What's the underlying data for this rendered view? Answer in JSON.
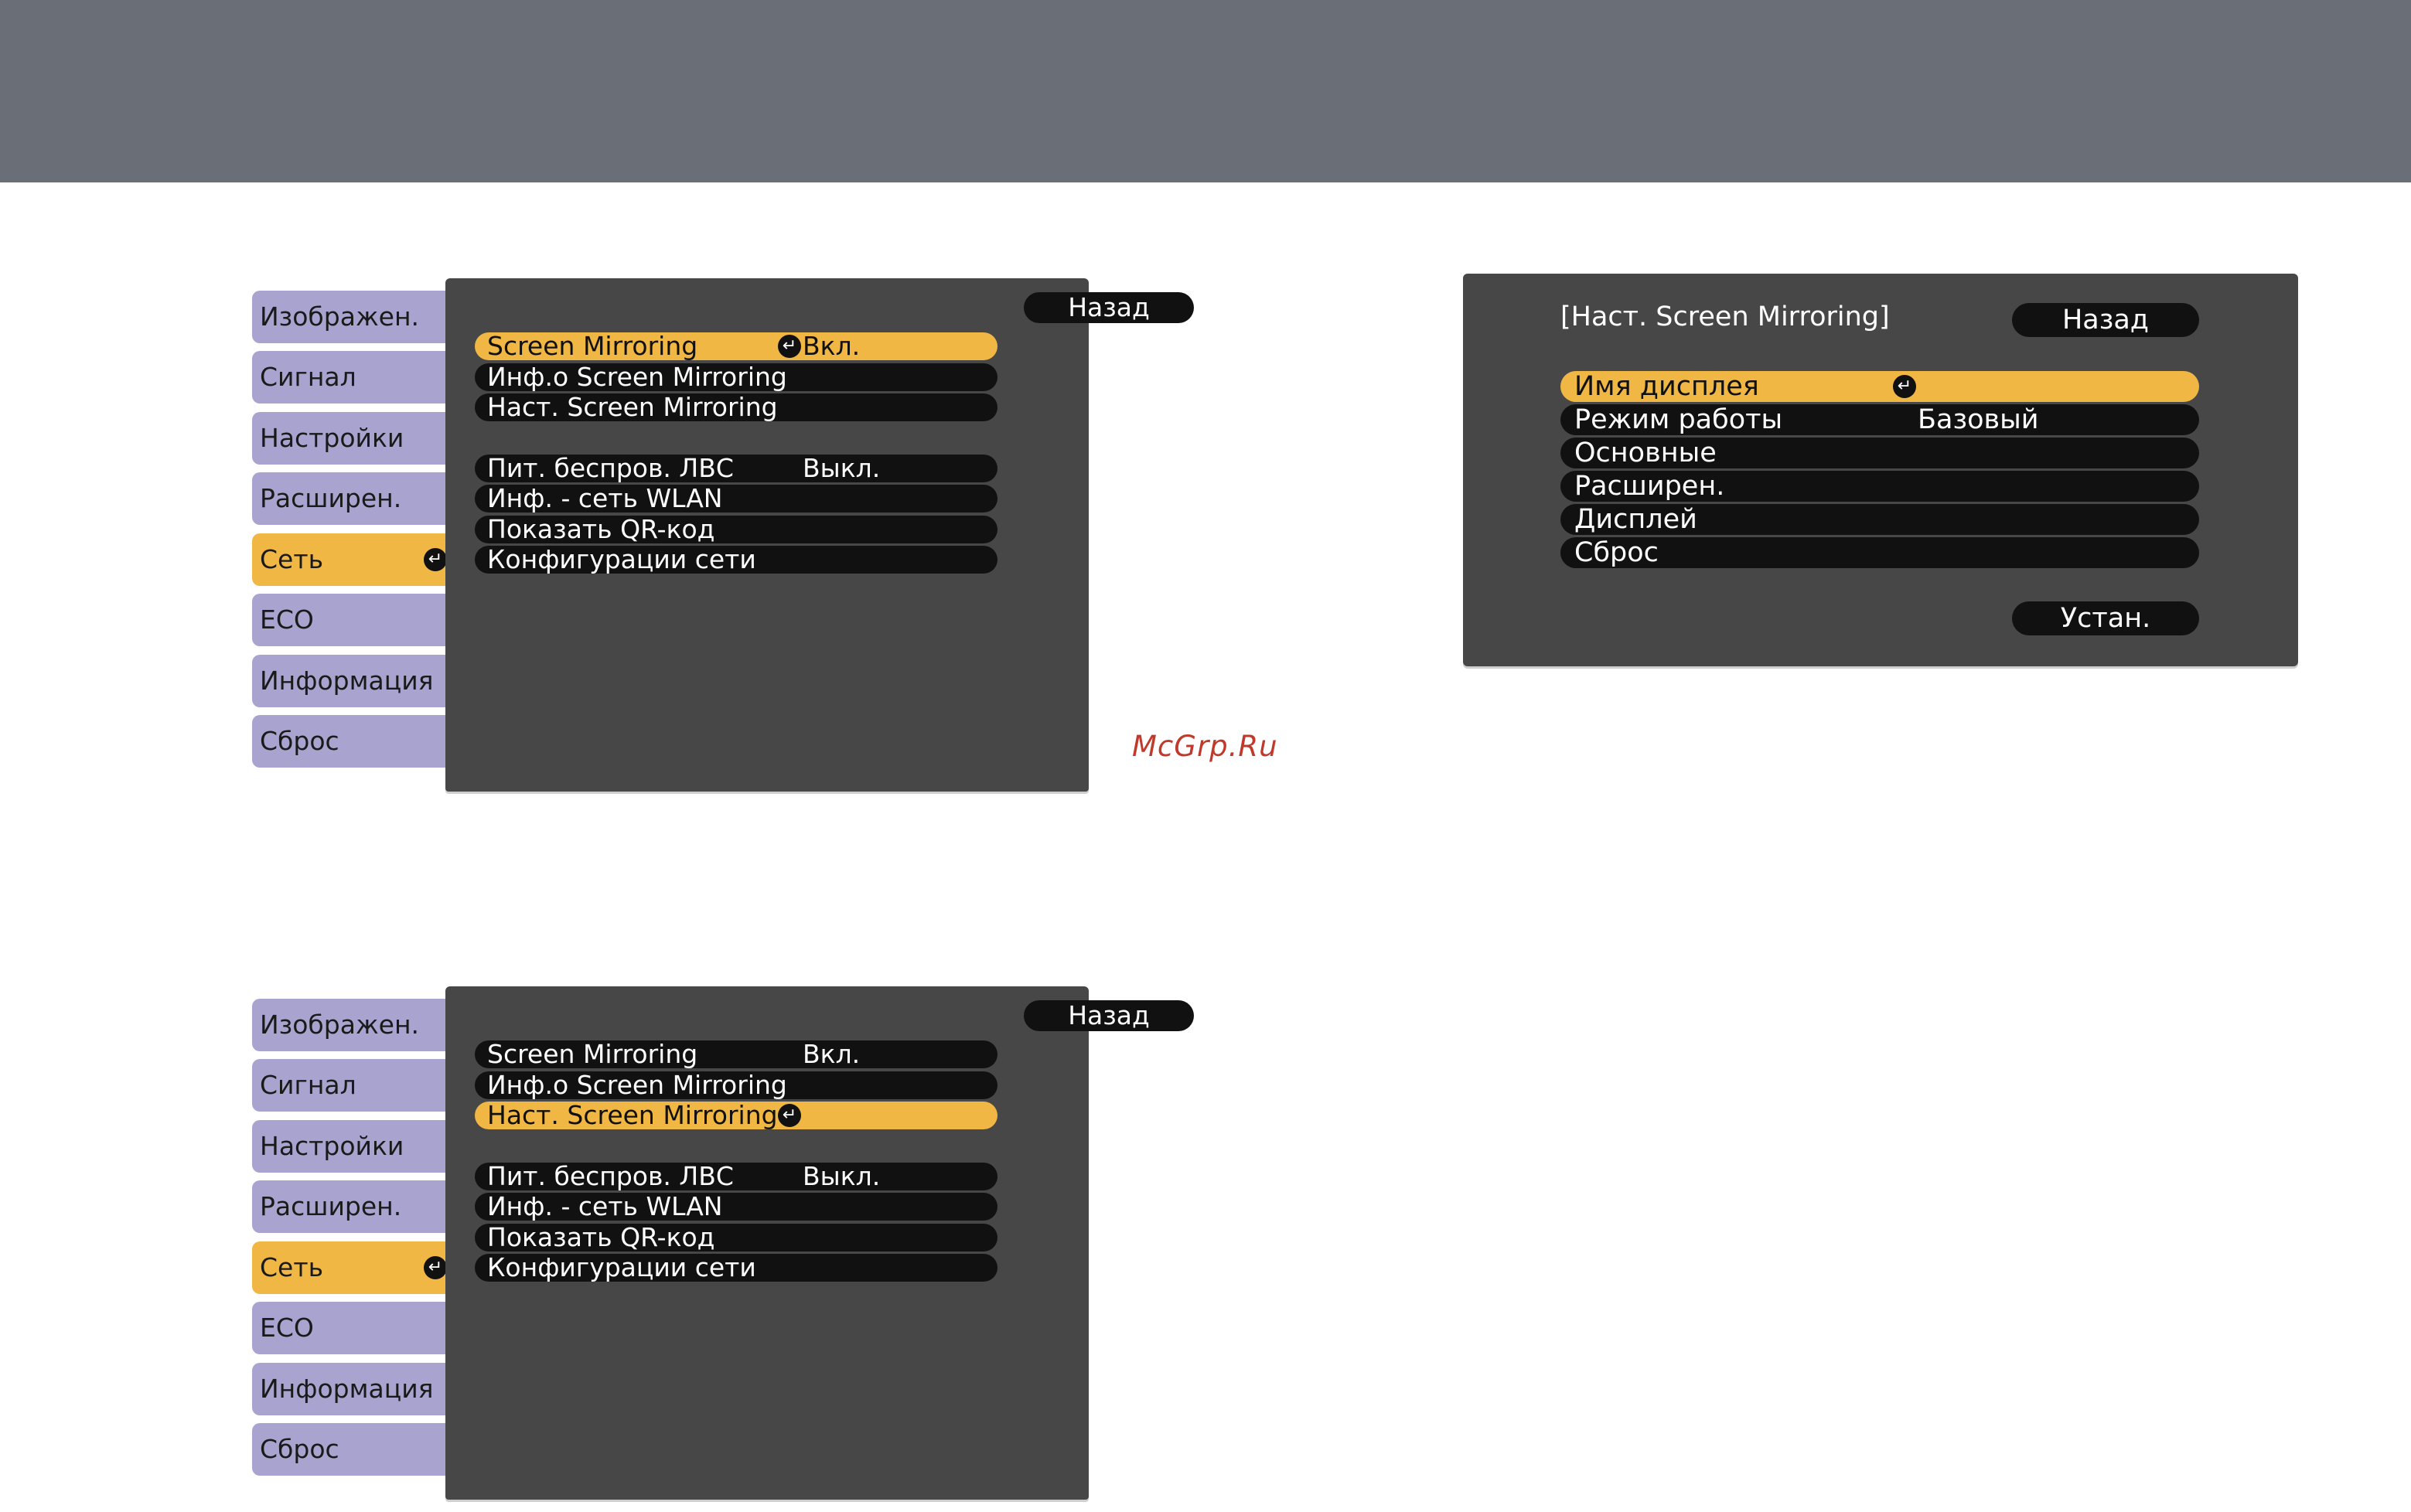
{
  "tabs": [
    "Изображен.",
    "Сигнал",
    "Настройки",
    "Расширен.",
    "Сеть",
    "ECO",
    "Информация",
    "Сброс"
  ],
  "menu1": {
    "back": "Назад",
    "items": [
      {
        "label": "Screen Mirroring",
        "value": "Вкл."
      },
      {
        "label": "Инф.о Screen Mirroring",
        "value": ""
      },
      {
        "label": "Наст. Screen Mirroring",
        "value": ""
      },
      {
        "label": "Пит. беспров. ЛВС",
        "value": "Выкл."
      },
      {
        "label": "Инф. - сеть WLAN",
        "value": ""
      },
      {
        "label": "Показать QR-код",
        "value": ""
      },
      {
        "label": "Конфигурации сети",
        "value": ""
      }
    ]
  },
  "menu2": {
    "back": "Назад",
    "items": [
      {
        "label": "Screen Mirroring",
        "value": "Вкл."
      },
      {
        "label": "Инф.о Screen Mirroring",
        "value": ""
      },
      {
        "label": "Наст. Screen Mirroring",
        "value": ""
      },
      {
        "label": "Пит. беспров. ЛВС",
        "value": "Выкл."
      },
      {
        "label": "Инф. - сеть WLAN",
        "value": ""
      },
      {
        "label": "Показать QR-код",
        "value": ""
      },
      {
        "label": "Конфигурации сети",
        "value": ""
      }
    ]
  },
  "dialog": {
    "title": "[Наст. Screen Mirroring]",
    "back": "Назад",
    "set": "Устан.",
    "items": [
      {
        "label": "Имя дисплея",
        "value": ""
      },
      {
        "label": "Режим работы",
        "value": "Базовый"
      },
      {
        "label": "Основные",
        "value": ""
      },
      {
        "label": "Расширен.",
        "value": ""
      },
      {
        "label": "Дисплей",
        "value": ""
      },
      {
        "label": "Сброс",
        "value": ""
      }
    ]
  },
  "enter_icon_glyph": "↵",
  "watermark": "McGrp.Ru",
  "colors": {
    "top_bar": "#6a6e77",
    "panel": "#474747",
    "tab": "#a9a4cf",
    "highlight": "#f0b744",
    "watermark": "#c0392b"
  }
}
